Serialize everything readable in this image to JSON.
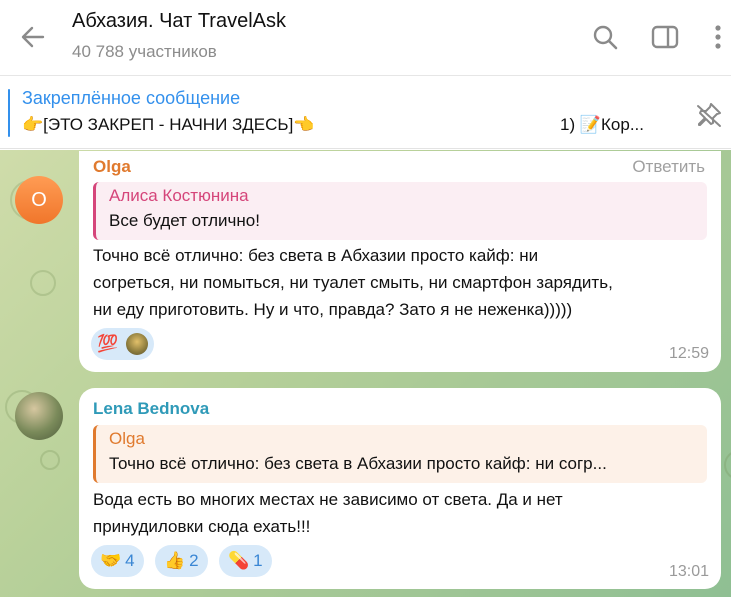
{
  "header": {
    "title": "Абхазия. Чат TravelAsk",
    "subtitle": "40 788 участников"
  },
  "pinned": {
    "label": "Закреплённое сообщение",
    "text": "👉[ЭТО ЗАКРЕП - НАЧНИ ЗДЕСЬ]👈",
    "text2": "1) 📝Кор..."
  },
  "messages": [
    {
      "sender": "Olga",
      "reply_label": "Ответить",
      "quote_name": "Алиса Костюнина",
      "quote_text": "Все будет отлично!",
      "text": "Точно всё отлично: без света в Абхазии просто кайф: ни\nсогреться, ни помыться, ни туалет смыть, ни смартфон зарядить,\nни еду приготовить. Ну и что, правда? Зато я не неженка)))))",
      "reaction_emoji": "💯",
      "time": "12:59",
      "avatar_letter": "O"
    },
    {
      "sender": "Lena Bednova",
      "quote_name": "Olga",
      "quote_text": "Точно всё отлично: без света в Абхазии просто кайф: ни согр...",
      "text": "Вода есть во многих местах не зависимо от света. Да и нет\nпринудиловки сюда ехать!!!",
      "reactions": [
        {
          "emoji": "🤝",
          "count": "4"
        },
        {
          "emoji": "👍",
          "count": "2"
        },
        {
          "emoji": "💊",
          "count": "1"
        }
      ],
      "time": "13:01"
    }
  ],
  "colors": {
    "accent": "#3390ec",
    "olga": "#e07a2e",
    "alisa": "#d5457a",
    "lena": "#2f9ab8"
  }
}
